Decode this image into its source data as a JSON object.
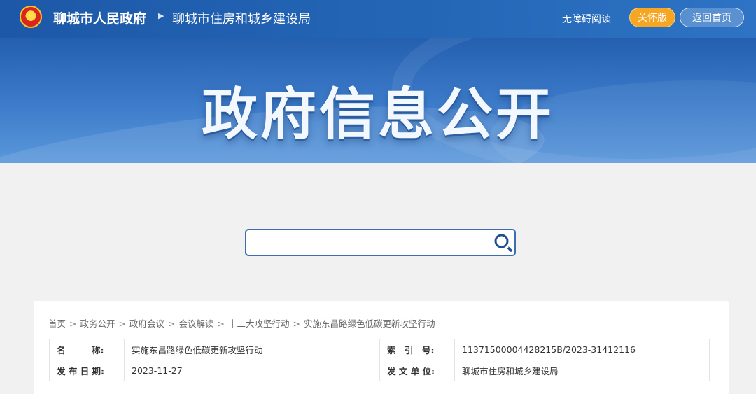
{
  "header": {
    "site_name": "聊城市人民政府",
    "dept_name": "聊城市住房和城乡建设局",
    "accessibility_label": "无障碍阅读",
    "care_mode_label": "关怀版",
    "home_label": "返回首页",
    "accent_orange": "#f6a623",
    "brand_blue": "#1d58a8"
  },
  "banner": {
    "title": "政府信息公开"
  },
  "search": {
    "placeholder": "",
    "value": ""
  },
  "breadcrumb": [
    "首页",
    "政务公开",
    "政府会议",
    "会议解读",
    "十二大攻坚行动",
    "实施东昌路绿色低碳更新攻坚行动"
  ],
  "info": {
    "name_label": "名　　　称:",
    "name_value": "实施东昌路绿色低碳更新攻坚行动",
    "index_label": "索　引　号:",
    "index_value": "11371500004428215B/2023-31412116",
    "date_label": "发 布 日 期:",
    "date_value": "2023-11-27",
    "issuer_label": "发 文 单 位:",
    "issuer_value": "聊城市住房和城乡建设局"
  }
}
